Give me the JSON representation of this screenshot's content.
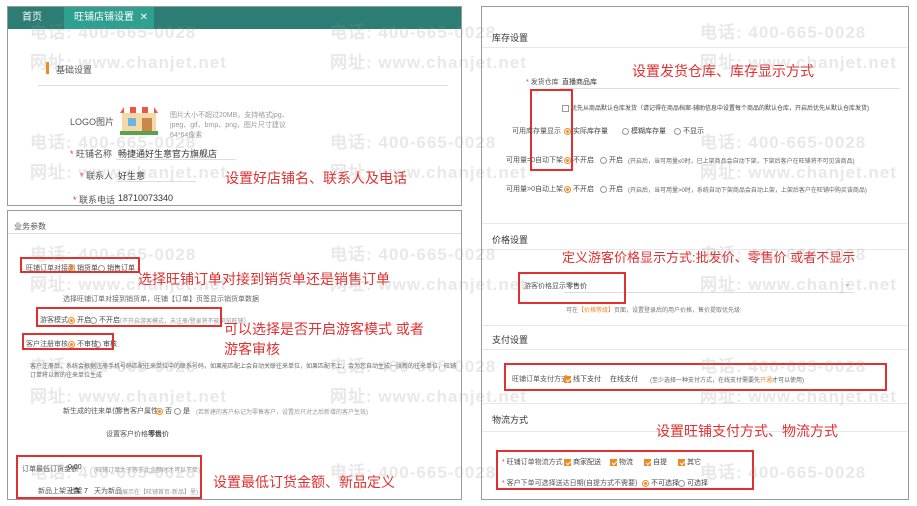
{
  "watermark": {
    "phone": "电话: 400-665-0028",
    "site": "网址: www.chanjet.net"
  },
  "top": {
    "tabs": {
      "home": "首页",
      "active": "旺铺店铺设置"
    },
    "section_title": "基础设置",
    "logo_label": "LOGO图片",
    "logo_hint": "图片大小不超过20MB，支持格式jpg、jpeg、gif、bmp、png，图片尺寸建议64*64像素",
    "shop_name_label": "旺铺名称",
    "shop_name_value": "畅捷通好生意官方旗舰店",
    "contact_label": "联系人",
    "contact_value": "好生意",
    "phone_label": "联系电话",
    "phone_value": "18710073340",
    "annotation": "设置好店铺名、联系人及电话"
  },
  "biz": {
    "title": "业务参数",
    "order_type_label": "旺铺订单对接到",
    "order_type_options": [
      "销货单",
      "销售订单"
    ],
    "order_type_hint": "选择旺铺订单对接到销货单，旺铺【订单】页签显示销货单数据",
    "guest_mode_label": "游客模式",
    "guest_mode_options": [
      "开启",
      "不开启"
    ],
    "guest_mode_hint": "（不开启游客模式，未注册/登录将不能浏览旺铺）",
    "guest_review_label": "客户注册审核",
    "guest_review_options": [
      "不审核",
      "审核"
    ],
    "guest_review_hint": "客户注册后，系统会根据注册手机号码匹配往来单位中的联系号码，如果能匹配上会自动关联往来单位，如果匹配不上，会为您自动生成一张新的往来单位，旺铺订单将以新的往来单位生成",
    "new_customer_label": "新生成的往来单位",
    "new_customer_attr_label": "零售客户属性",
    "new_customer_options": [
      "否",
      "是"
    ],
    "new_customer_hint": "(若新建的客户标记为零售客户，设置后只对之后新增的客户生效)",
    "price_setting_label": "设置客户价格等级",
    "price_setting_value": "零售价",
    "min_order_label": "订单最低订货金额",
    "min_order_value": "0.00",
    "min_order_hint": "(旺铺订单大于等于此金额时才可以下单)",
    "new_product_label": "新品上架天数",
    "new_product_value": "上架 7",
    "new_product_unit": "天为新品",
    "new_product_hint": "(展示在【旺铺首页-新品】里)",
    "anno_order": "选择旺铺订单对接到销货单还是销售订单",
    "anno_guest_1": "可以选择是否开启游客模式 或者",
    "anno_guest_2": "游客审核",
    "anno_min": "设置最低订货金额、新品定义"
  },
  "right": {
    "stock_title": "库存设置",
    "warehouse_label": "发货仓库",
    "warehouse_value": "直播商品库",
    "warehouse_check": "优先从商品默认仓库发货（请记得在商品档案-辅助信息中设置每个商品的默认仓库，开启后优先从默认仓库发货)",
    "stock_display_label": "可用库存量显示",
    "stock_display_options": [
      "实际库存量",
      "模糊库存量",
      "不显示"
    ],
    "auto_off_label": "可用量=0自动下架",
    "auto_off_options": [
      "不开启",
      "开启"
    ],
    "auto_off_hint": "(开启后，当可用量≤0时，已上架商品会自动下架，下架后客户在旺铺将不可见该商品)",
    "auto_on_label": "可用量>0自动上架",
    "auto_on_options": [
      "不开启",
      "开启"
    ],
    "auto_on_hint": "(开启后，当可用量>0时，系统自动下架商品会自动上架，上架后客户在旺铺中购买该商品)",
    "anno_stock": "设置发货仓库、库存显示方式",
    "price_title": "价格设置",
    "guest_price_label": "游客价格显示",
    "guest_price_value": "零售价",
    "guest_price_hint_pre": "可在",
    "guest_price_hint_link": "【价格等级】",
    "guest_price_hint_post": "页面，设置登录后的用户价格，售价提取优先级",
    "anno_price": "定义游客价格显示方式:批发价、零售价 或者不显示",
    "pay_title": "支付设置",
    "pay_label": "旺铺订单支付方式",
    "pay_options": [
      "线下支付",
      "在线支付"
    ],
    "pay_hint_pre": "(至少选择一种支付方式，在线支付需要先",
    "pay_hint_link": "开通",
    "pay_hint_post": "才可以使用)",
    "ship_title": "物流方式",
    "ship_label": "旺铺订单物流方式",
    "ship_options": [
      "商家配送",
      "物流",
      "自提",
      "其它"
    ],
    "ship_date_label": "客户下单可选择送达日期(自提方式不需要)",
    "ship_date_options": [
      "不可选择",
      "可选择"
    ],
    "anno_pay": "设置旺铺支付方式、物流方式"
  }
}
